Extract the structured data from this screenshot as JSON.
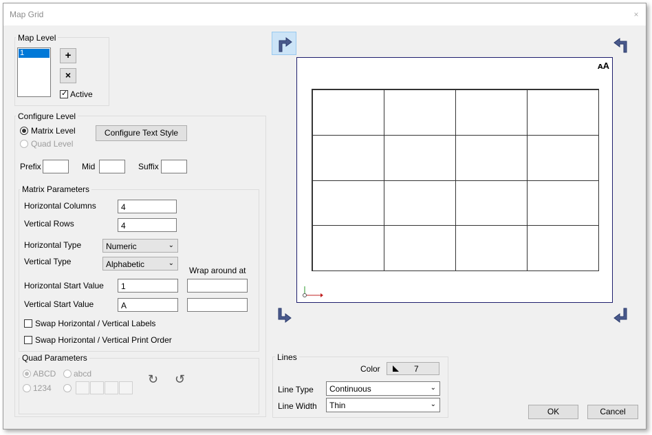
{
  "window": {
    "title": "Map Grid",
    "close_glyph": "×"
  },
  "map_level": {
    "group_label": "Map Level",
    "levels": [
      "1"
    ],
    "add_glyph": "+",
    "remove_glyph": "×",
    "active_label": "Active",
    "active_checked": true
  },
  "configure_level": {
    "group_label": "Configure Level",
    "matrix_level_label": "Matrix Level",
    "quad_level_label": "Quad Level",
    "configure_text_style_label": "Configure Text Style",
    "prefix_label": "Prefix",
    "mid_label": "Mid",
    "suffix_label": "Suffix",
    "prefix_value": "",
    "mid_value": "",
    "suffix_value": ""
  },
  "matrix_parameters": {
    "group_label": "Matrix Parameters",
    "horizontal_columns_label": "Horizontal Columns",
    "horizontal_columns_value": "4",
    "vertical_rows_label": "Vertical Rows",
    "vertical_rows_value": "4",
    "horizontal_type_label": "Horizontal Type",
    "horizontal_type_value": "Numeric",
    "vertical_type_label": "Vertical Type",
    "vertical_type_value": "Alphabetic",
    "wrap_label": "Wrap around at",
    "horizontal_start_label": "Horizontal Start Value",
    "horizontal_start_value": "1",
    "horizontal_wrap_value": "",
    "vertical_start_label": "Vertical Start Value",
    "vertical_start_value": "A",
    "vertical_wrap_value": "",
    "swap_labels_label": "Swap Horizontal / Vertical Labels",
    "swap_print_label": "Swap Horizontal / Vertical Print Order",
    "swap_labels_checked": false,
    "swap_print_checked": false
  },
  "quad_parameters": {
    "group_label": "Quad Parameters",
    "upper_label": "ABCD",
    "lower_label": "abcd",
    "numeric_label": "1234",
    "rotate_cw_glyph": "↻",
    "rotate_ccw_glyph": "↺"
  },
  "preview": {
    "columns": 4,
    "rows": 4,
    "text_size_icon": "ᴀA",
    "corners": [
      "corner-top-left-icon",
      "corner-top-right-icon",
      "corner-bottom-left-icon",
      "corner-bottom-right-icon"
    ],
    "selected_corner": "top-left",
    "arrow_color": "#4a5a8c",
    "selected_bg": "#cce4f7"
  },
  "lines": {
    "group_label": "Lines",
    "color_label": "Color",
    "color_value": "7",
    "line_type_label": "Line Type",
    "line_type_value": "Continuous",
    "line_width_label": "Line Width",
    "line_width_value": "Thin"
  },
  "buttons": {
    "ok": "OK",
    "cancel": "Cancel"
  }
}
